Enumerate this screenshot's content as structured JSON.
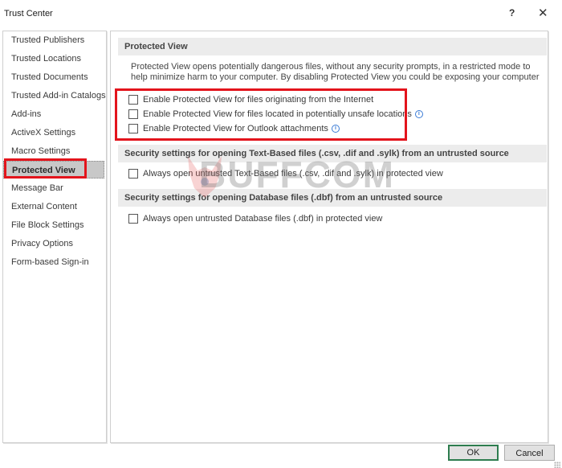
{
  "window": {
    "title": "Trust Center",
    "help_label": "?",
    "close_label": "✕"
  },
  "sidebar": {
    "selected": "Protected View",
    "items": [
      {
        "label": "Trusted Publishers"
      },
      {
        "label": "Trusted Locations"
      },
      {
        "label": "Trusted Documents"
      },
      {
        "label": "Trusted Add-in Catalogs"
      },
      {
        "label": "Add-ins"
      },
      {
        "label": "ActiveX Settings"
      },
      {
        "label": "Macro Settings"
      },
      {
        "label": "Protected View"
      },
      {
        "label": "Message Bar"
      },
      {
        "label": "External Content"
      },
      {
        "label": "File Block Settings"
      },
      {
        "label": "Privacy Options"
      },
      {
        "label": "Form-based Sign-in"
      }
    ]
  },
  "main": {
    "sections": [
      {
        "header": "Protected View",
        "description": "Protected View opens potentially dangerous files, without any security prompts, in a restricted mode to help minimize harm to your computer. By disabling Protected View you could be exposing your computer to possible security threats.",
        "options": [
          {
            "label": "Enable Protected View for files originating from the Internet",
            "checked": false,
            "info": false
          },
          {
            "label": "Enable Protected View for files located in potentially unsafe locations",
            "checked": false,
            "info": true
          },
          {
            "label": "Enable Protected View for Outlook attachments",
            "checked": false,
            "info": true
          }
        ]
      },
      {
        "header": "Security settings for opening Text-Based files (.csv, .dif and .sylk) from an untrusted source",
        "options": [
          {
            "label": "Always open untrusted Text-Based files (.csv, .dif and .sylk) in protected view",
            "checked": false
          }
        ]
      },
      {
        "header": "Security settings for opening Database files (.dbf) from an untrusted source",
        "options": [
          {
            "label": "Always open untrusted Database files (.dbf) in protected view",
            "checked": false
          }
        ]
      }
    ]
  },
  "footer": {
    "ok_label": "OK",
    "cancel_label": "Cancel"
  },
  "annotations": {
    "highlight_color": "#e3141c"
  },
  "watermark": {
    "text": "BUFFCOM"
  },
  "info_icon_glyph": "i"
}
